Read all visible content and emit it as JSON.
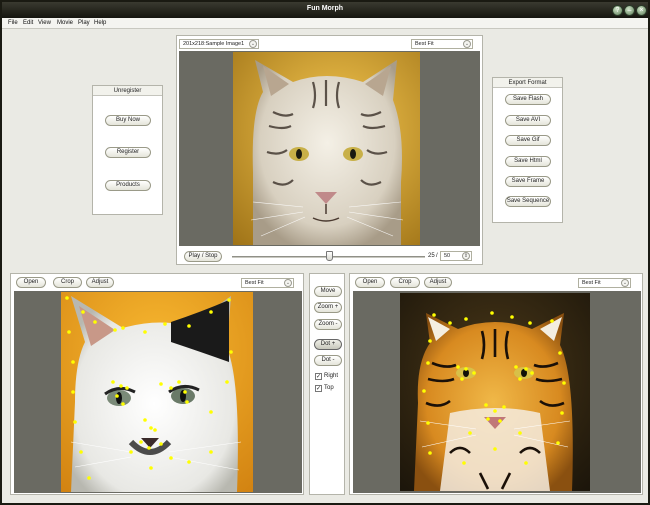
{
  "window": {
    "title": "Fun Morph"
  },
  "menu": [
    "File",
    "Edit",
    "View",
    "Movie",
    "Play",
    "Help"
  ],
  "unregister_panel": {
    "title": "Unregister",
    "buttons": [
      "Buy Now",
      "Register",
      "Products"
    ]
  },
  "export_panel": {
    "title": "Export Format",
    "buttons": [
      "Save Flash",
      "Save AVI",
      "Save Gif",
      "Save Html",
      "Save Frame",
      "Save Sequence"
    ]
  },
  "preview": {
    "sample_select": "201x218:Sample Image1",
    "fit_select": "Best Fit",
    "play_label": "Play / Stop",
    "frame_current": "25",
    "frame_sep": "/",
    "frame_total": "50",
    "slider_fraction": 0.5
  },
  "left_image_panel": {
    "buttons": [
      "Open",
      "Crop",
      "Adjust"
    ],
    "fit_select": "Best Fit"
  },
  "right_image_panel": {
    "buttons": [
      "Open",
      "Crop",
      "Adjust"
    ],
    "fit_select": "Best Fit"
  },
  "tools": {
    "buttons": [
      "Move",
      "Zoom +",
      "Zoom -",
      "Dot +",
      "Dot -"
    ],
    "checks": [
      {
        "label": "Right",
        "checked": true
      },
      {
        "label": "Top",
        "checked": true
      }
    ]
  },
  "colors": {
    "title_bar": "#1a1a12",
    "dot": "#ffff00",
    "canvas_bg": "#6a6a62",
    "cat_bg": "#f0a020"
  }
}
